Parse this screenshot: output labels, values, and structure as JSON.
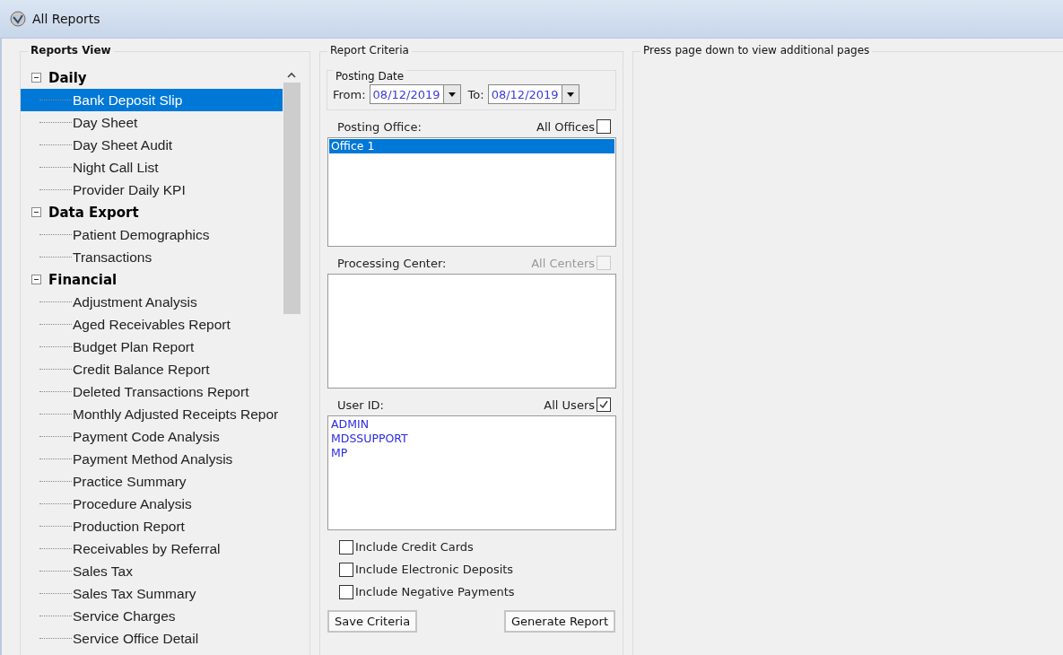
{
  "window": {
    "title": "All Reports"
  },
  "reports_view": {
    "title": "Reports View",
    "categories": [
      {
        "label": "Daily",
        "expanded": true,
        "children": [
          {
            "label": "Bank Deposit Slip",
            "selected": true
          },
          {
            "label": "Day Sheet",
            "selected": false
          },
          {
            "label": "Day Sheet Audit",
            "selected": false
          },
          {
            "label": "Night Call List",
            "selected": false
          },
          {
            "label": "Provider Daily KPI",
            "selected": false
          }
        ]
      },
      {
        "label": "Data Export",
        "expanded": true,
        "children": [
          {
            "label": "Patient Demographics",
            "selected": false
          },
          {
            "label": "Transactions",
            "selected": false
          }
        ]
      },
      {
        "label": "Financial",
        "expanded": true,
        "children": [
          {
            "label": "Adjustment Analysis",
            "selected": false
          },
          {
            "label": "Aged Receivables Report",
            "selected": false
          },
          {
            "label": "Budget Plan Report",
            "selected": false
          },
          {
            "label": "Credit Balance Report",
            "selected": false
          },
          {
            "label": "Deleted Transactions Report",
            "selected": false
          },
          {
            "label": "Monthly Adjusted Receipts Repor",
            "selected": false
          },
          {
            "label": "Payment Code Analysis",
            "selected": false
          },
          {
            "label": "Payment Method Analysis",
            "selected": false
          },
          {
            "label": "Practice Summary",
            "selected": false
          },
          {
            "label": "Procedure Analysis",
            "selected": false
          },
          {
            "label": "Production Report",
            "selected": false
          },
          {
            "label": "Receivables by Referral",
            "selected": false
          },
          {
            "label": "Sales Tax",
            "selected": false
          },
          {
            "label": "Sales Tax Summary",
            "selected": false
          },
          {
            "label": "Service Charges",
            "selected": false
          },
          {
            "label": "Service Office Detail",
            "selected": false
          }
        ]
      }
    ]
  },
  "report_criteria": {
    "title": "Report Criteria",
    "posting_date": {
      "title": "Posting Date",
      "from_label": "From:",
      "from_value": "08/12/2019",
      "to_label": "To:",
      "to_value": "08/12/2019"
    },
    "lists": [
      {
        "label": "Posting Office:",
        "all_label": "All Offices",
        "all_checked": false,
        "all_disabled": false,
        "items": [
          {
            "label": "Office 1",
            "selected": true
          }
        ]
      },
      {
        "label": "Processing Center:",
        "all_label": "All Centers",
        "all_checked": false,
        "all_disabled": true
      },
      {
        "label": "User ID:",
        "all_label": "All Users",
        "all_checked": true,
        "all_disabled": false,
        "items": [
          {
            "label": "ADMIN",
            "selected": false
          },
          {
            "label": "MDSSUPPORT",
            "selected": false
          },
          {
            "label": "MP",
            "selected": false
          }
        ]
      }
    ],
    "options": [
      {
        "label": "Include Credit Cards",
        "checked": false
      },
      {
        "label": "Include Electronic Deposits",
        "checked": false
      },
      {
        "label": "Include Negative Payments",
        "checked": false
      }
    ],
    "buttons": [
      "Save Criteria",
      "Generate Report"
    ]
  },
  "preview": {
    "title": "Press page down to view additional pages"
  }
}
